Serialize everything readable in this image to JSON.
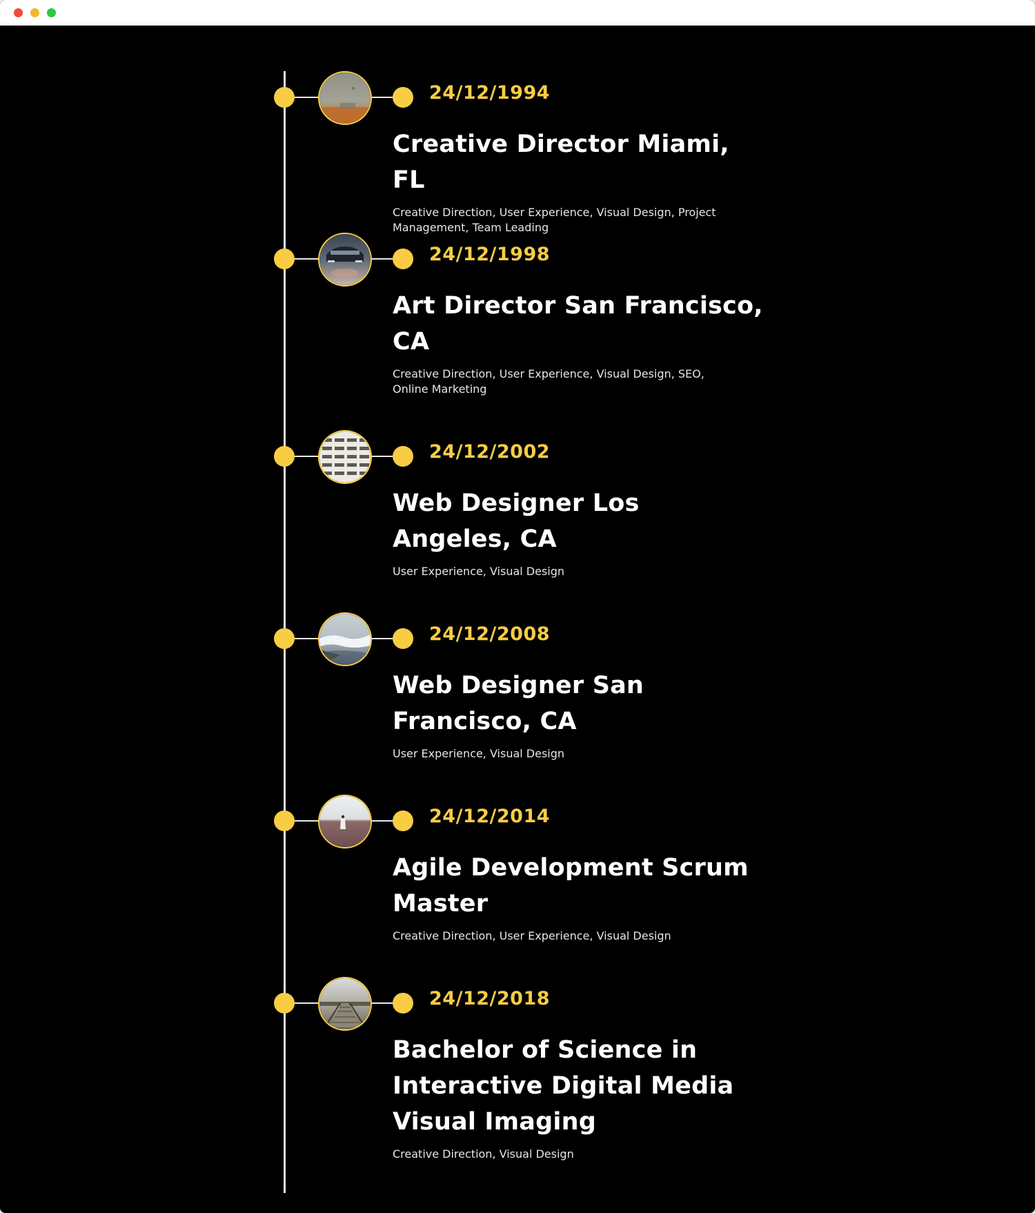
{
  "window": {
    "controls": [
      "close",
      "minimize",
      "maximize"
    ],
    "control_colors": {
      "close": "#ed4b3f",
      "minimize": "#f5b52e",
      "maximize": "#2ac840"
    }
  },
  "theme": {
    "accent": "#f8cd44",
    "background": "#000000",
    "line": "#e9e9e9"
  },
  "timeline": {
    "items": [
      {
        "date": "24/12/1994",
        "title": "Creative Director Miami, FL",
        "description": "Creative Direction, User Experience, Visual Design, Project Management, Team Leading",
        "image_icon": "foggy-landscape-photo-icon"
      },
      {
        "date": "24/12/1998",
        "title": "Art Director San Francisco, CA",
        "description": "Creative Direction, User Experience, Visual Design, SEO, Online Marketing",
        "image_icon": "car-night-photo-icon"
      },
      {
        "date": "24/12/2002",
        "title": "Web Designer Los Angeles, CA",
        "description": "User Experience, Visual Design",
        "image_icon": "building-facade-photo-icon"
      },
      {
        "date": "24/12/2008",
        "title": "Web Designer San Francisco, CA",
        "description": "User Experience, Visual Design",
        "image_icon": "ocean-waves-photo-icon"
      },
      {
        "date": "24/12/2014",
        "title": "Agile Development Scrum Master",
        "description": "Creative Direction, User Experience, Visual Design",
        "image_icon": "person-field-photo-icon"
      },
      {
        "date": "24/12/2018",
        "title": "Bachelor of Science in Interactive Digital Media Visual Imaging",
        "description": "Creative Direction, Visual Design",
        "image_icon": "boardwalk-pier-photo-icon"
      }
    ]
  }
}
